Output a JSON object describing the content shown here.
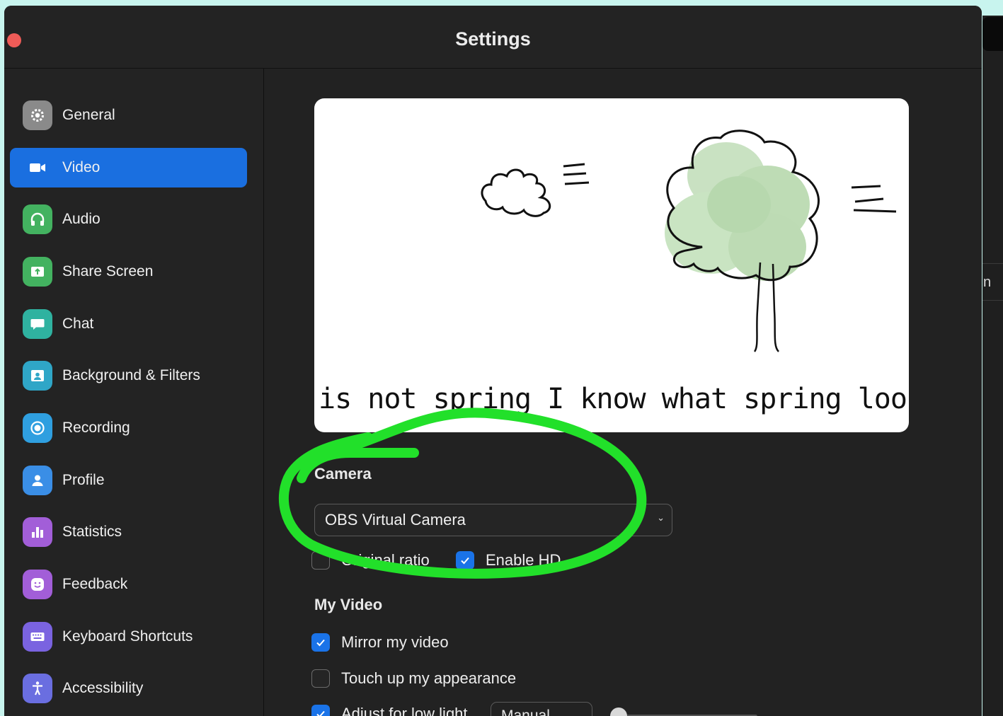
{
  "window": {
    "title": "Settings"
  },
  "sidebar": {
    "items": [
      {
        "label": "General",
        "icon": "gear-icon",
        "color": "#8e8e8e"
      },
      {
        "label": "Video",
        "icon": "video-camera-icon",
        "color": "#1a6fe0",
        "active": true
      },
      {
        "label": "Audio",
        "icon": "headphones-icon",
        "color": "#3fae5a"
      },
      {
        "label": "Share Screen",
        "icon": "share-screen-icon",
        "color": "#3fae5a"
      },
      {
        "label": "Chat",
        "icon": "chat-bubble-icon",
        "color": "#2fb2a0"
      },
      {
        "label": "Background & Filters",
        "icon": "background-person-icon",
        "color": "#2fa6c7"
      },
      {
        "label": "Recording",
        "icon": "record-icon",
        "color": "#2f9fe0"
      },
      {
        "label": "Profile",
        "icon": "profile-icon",
        "color": "#3a8ee6"
      },
      {
        "label": "Statistics",
        "icon": "bar-chart-icon",
        "color": "#a25ed8"
      },
      {
        "label": "Feedback",
        "icon": "smiley-icon",
        "color": "#a25ed8"
      },
      {
        "label": "Keyboard Shortcuts",
        "icon": "keyboard-icon",
        "color": "#7a63e0"
      },
      {
        "label": "Accessibility",
        "icon": "accessibility-icon",
        "color": "#6a6ee0"
      }
    ]
  },
  "preview": {
    "caption": "is not spring I know what spring looks and"
  },
  "camera": {
    "section_title": "Camera",
    "selected": "OBS Virtual Camera",
    "original_ratio_label": "Original ratio",
    "original_ratio_checked": false,
    "enable_hd_label": "Enable HD",
    "enable_hd_checked": true
  },
  "my_video": {
    "section_title": "My Video",
    "mirror_label": "Mirror my video",
    "mirror_checked": true,
    "touch_up_label": "Touch up my appearance",
    "touch_up_checked": false,
    "low_light_label": "Adjust for low light",
    "low_light_checked": true,
    "low_light_mode": "Manual",
    "low_light_level": 0
  },
  "background_window": {
    "glyph": "n"
  },
  "colors": {
    "accent": "#1a6fe0",
    "annotation": "#22e02a"
  }
}
